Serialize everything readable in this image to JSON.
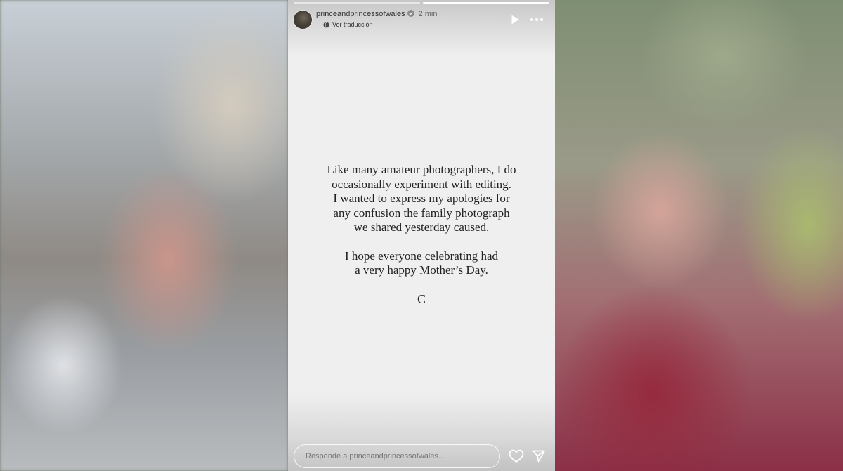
{
  "story": {
    "progress_segments": 2,
    "active_segment": 2,
    "header": {
      "username": "princeandprincessofwales",
      "verified": true,
      "time": "2 min",
      "translate_label": "Ver traducción",
      "avatar_icon": "avatar-photo",
      "play_icon": "play-icon",
      "more_icon": "more-icon"
    },
    "message": {
      "paragraph1": [
        "Like many amateur photographers, I do",
        "occasionally experiment with editing.",
        "I wanted to express my apologies for",
        "any confusion the family photograph",
        "we shared yesterday caused."
      ],
      "paragraph2": [
        "I hope everyone celebrating had",
        "a very happy Mother’s Day."
      ],
      "signature": "C"
    },
    "footer": {
      "reply_placeholder": "Responde a princeandprincessofwales...",
      "heart_icon": "heart-icon",
      "share_icon": "send-icon"
    },
    "colors": {
      "story_background": "#efefef",
      "text": "#222222",
      "verified_badge": "#3897f0"
    }
  }
}
